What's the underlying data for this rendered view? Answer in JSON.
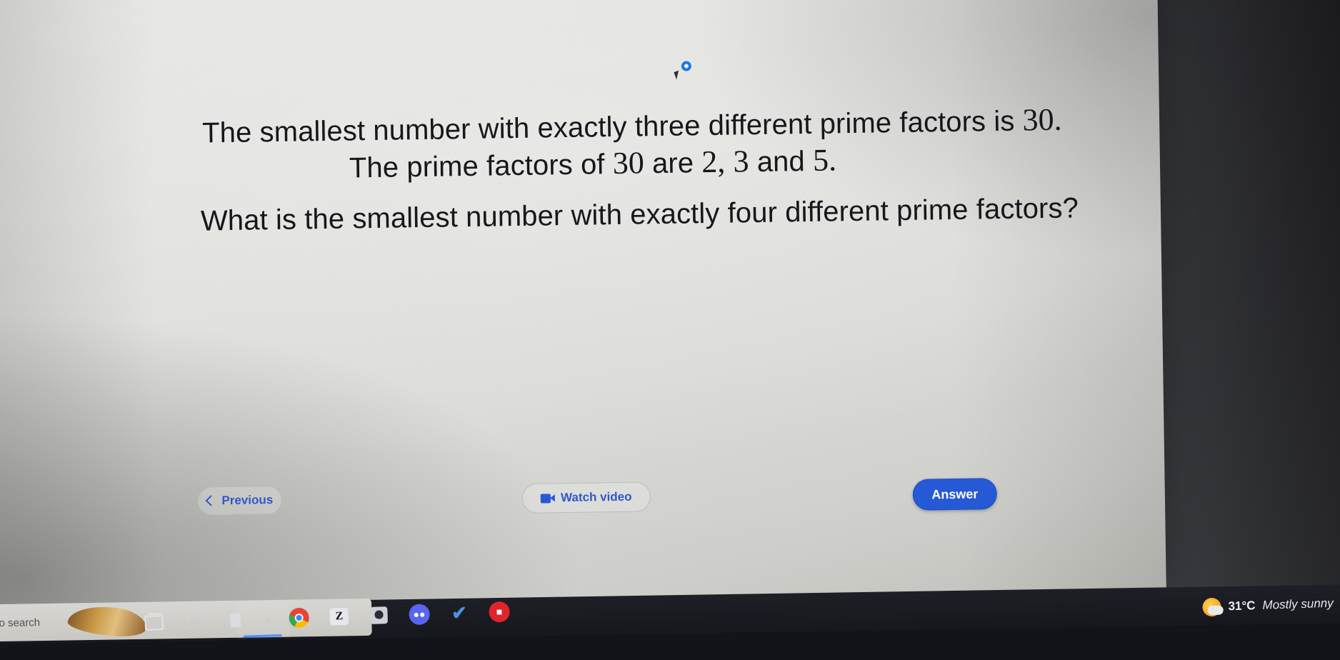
{
  "question": {
    "line1_prefix": "The smallest number with exactly three different prime factors is ",
    "line1_number": "30",
    "line1_suffix": ".",
    "line2_prefix": "The prime factors of ",
    "line2_n1": "30",
    "line2_mid1": " are ",
    "line2_n2": "2,",
    "line2_n3": "3",
    "line2_mid2": " and ",
    "line2_n4": "5",
    "line2_suffix": ".",
    "line3": "What is the smallest number with exactly four different prime factors?"
  },
  "footer": {
    "previous_label": "Previous",
    "watch_video_label": "Watch video",
    "answer_label": "Answer",
    "accent_blue": "#2558d6",
    "link_blue": "#2f57c8"
  },
  "taskbar": {
    "search_text": "to search",
    "links_label": "Links",
    "quote_glyph": "»",
    "weather": {
      "temperature": "31°C",
      "condition": "Mostly sunny"
    },
    "icons": [
      {
        "name": "task-view-icon"
      },
      {
        "name": "document-icon"
      },
      {
        "name": "chrome-icon"
      },
      {
        "name": "zotero-icon",
        "glyph": "Z"
      },
      {
        "name": "app-bell-icon"
      },
      {
        "name": "discord-icon",
        "glyph": "●●"
      },
      {
        "name": "checkmark-icon",
        "glyph": "✔"
      },
      {
        "name": "app-red-icon",
        "glyph": "■"
      }
    ]
  }
}
